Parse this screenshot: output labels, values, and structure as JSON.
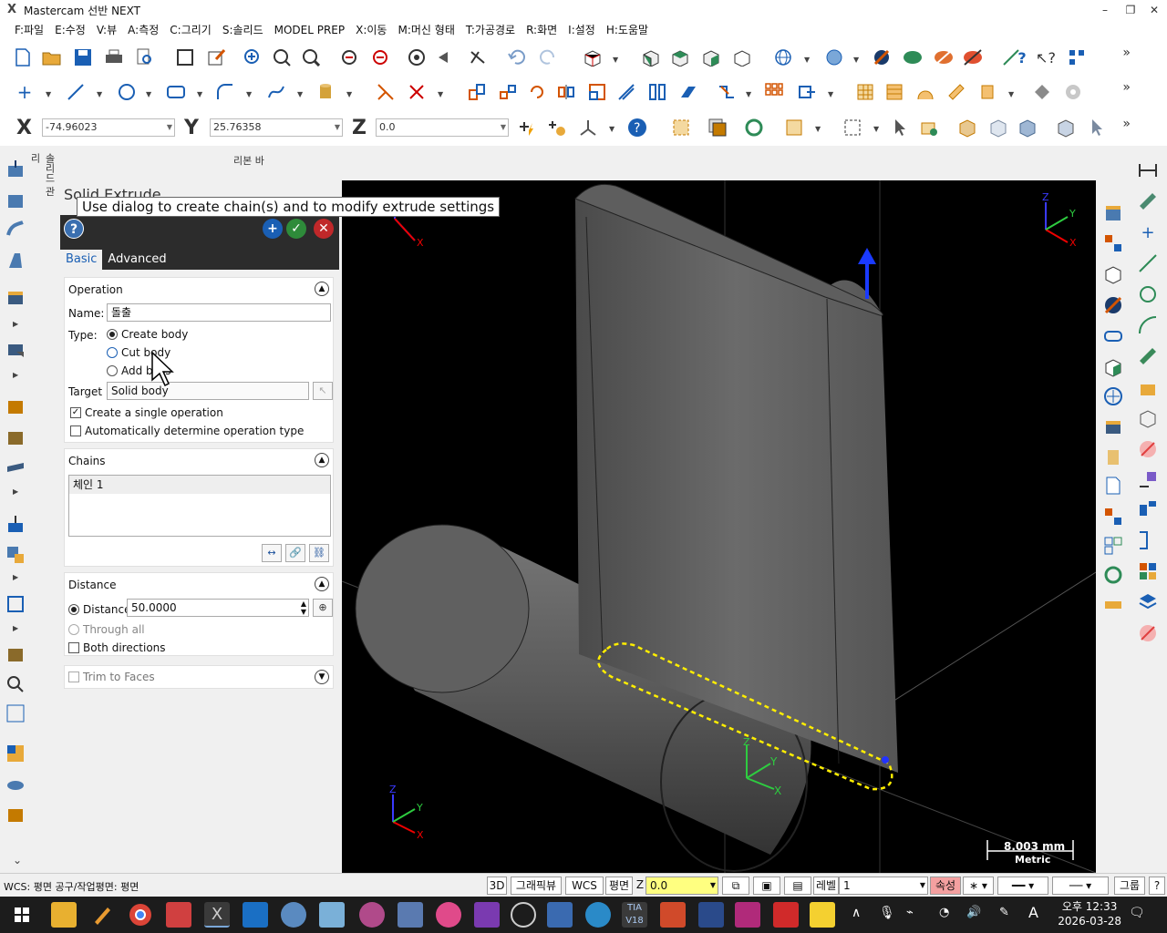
{
  "window": {
    "title": "Mastercam 선반 NEXT",
    "logo": "X",
    "minimize": "–",
    "restore": "❐",
    "close": "✕"
  },
  "menu": [
    "F:파일",
    "E:수정",
    "V:뷰",
    "A:측정",
    "C:그리기",
    "S:솔리드",
    "MODEL PREP",
    "X:이동",
    "M:머신 형태",
    "T:가공경로",
    "R:화면",
    "I:설정",
    "H:도움말"
  ],
  "overflow": "»",
  "coords": {
    "x_label": "X",
    "x_value": "-74.96023",
    "y_label": "Y",
    "y_value": "25.76358",
    "z_label": "Z",
    "z_value": "0.0"
  },
  "ribbon_label": "리본 바",
  "vertical_tab": "솔리드 관리",
  "panel": {
    "title": "Solid Extrude",
    "tooltip": "Use dialog to create chain(s) and to modify extrude settings",
    "help": "?",
    "tabs": [
      "Basic",
      "Advanced"
    ],
    "operation": {
      "header": "Operation",
      "name_label": "Name:",
      "name_value": "돌출",
      "type_label": "Type:",
      "types": [
        "Create body",
        "Cut body",
        "Add boss"
      ],
      "target_label": "Target",
      "target_value": "Solid body",
      "single_op": "Create a single operation",
      "auto_type": "Automatically determine operation type"
    },
    "chains": {
      "header": "Chains",
      "items": [
        "체인  1"
      ]
    },
    "distance": {
      "header": "Distance",
      "distance_label": "Distance",
      "distance_value": "50.0000",
      "through_all": "Through all",
      "both_directions": "Both directions"
    },
    "trim": {
      "header": "Trim to Faces"
    }
  },
  "viewport": {
    "scale_value": "8.003 mm",
    "scale_unit": "Metric"
  },
  "status": {
    "wcs_text": "WCS: 평면  공구/작업평면: 평면",
    "view3d": "3D",
    "graphic_view": "그래픽뷰",
    "wcs": "WCS",
    "plane": "평면",
    "z_label": "Z",
    "z_value": "0.0",
    "level_label": "레벨",
    "level_value": "1",
    "attr_label": "속성",
    "group_label": "그룹"
  },
  "clock": {
    "time": "오후 12:33",
    "date": "2026-03-28"
  },
  "colors": {
    "accent": "#1a5fb4",
    "dark_bar": "#2c2c2c",
    "viewport": "#000000",
    "chain_highlight": "#ffff00"
  }
}
